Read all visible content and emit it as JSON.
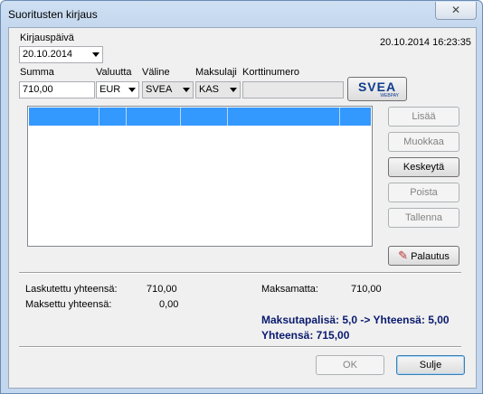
{
  "window": {
    "title": "Suoritusten kirjaus",
    "close_glyph": "✕"
  },
  "header": {
    "date_label": "Kirjauspäivä",
    "date_value": "20.10.2014",
    "timestamp": "20.10.2014 16:23:35"
  },
  "form": {
    "sum_label": "Summa",
    "sum_value": "710,00",
    "currency_label": "Valuutta",
    "currency_value": "EUR",
    "medium_label": "Väline",
    "medium_value": "SVEA",
    "method_label": "Maksulaji",
    "method_value": "KAS",
    "card_label": "Korttinumero",
    "card_value": ""
  },
  "svea_logo": {
    "text": "SVEA",
    "subtext": "WEBPAY",
    "color": "#0f3d8c"
  },
  "buttons": {
    "add": "Lisää",
    "edit": "Muokkaa",
    "abort": "Keskeytä",
    "delete": "Poista",
    "save": "Tallenna",
    "refund": "Palautus",
    "ok": "OK",
    "close": "Sulje"
  },
  "totals": {
    "invoiced_label": "Laskutettu yhteensä:",
    "invoiced_value": "710,00",
    "paid_label": "Maksettu yhteensä:",
    "paid_value": "0,00",
    "unpaid_label": "Maksamatta:",
    "unpaid_value": "710,00",
    "surcharge_text": "Maksutapalisä: 5,0 -> Yhteensä: 5,00",
    "total_text": "Yhteensä: 715,00"
  },
  "colors": {
    "accent_text": "#0a1a6e",
    "selection": "#3399ff"
  }
}
